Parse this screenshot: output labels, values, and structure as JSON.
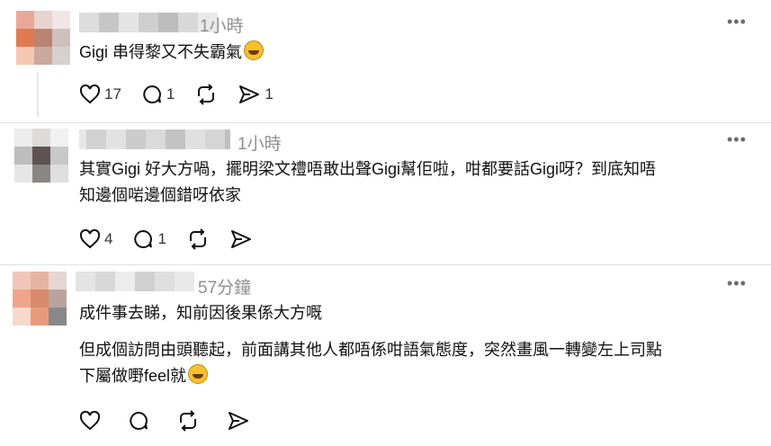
{
  "comments": [
    {
      "time": "1小時",
      "text_lines": [
        "Gigi 串得黎又不失霸氣"
      ],
      "likes": "17",
      "replies": "1",
      "shares": "1",
      "emoji": "rolling-laughing-emoji"
    },
    {
      "time": "1小時",
      "text_lines": [
        "其實Gigi 好大方喎，擺明梁文禮唔敢出聲Gigi幫佢啦，咁都要話Gigi呀？到底知唔",
        "知邊個啱邊個錯呀依家"
      ],
      "likes": "4",
      "replies": "1"
    },
    {
      "time": "57分鐘",
      "text_lines": [
        "成件事去睇，知前因後果係大方嘅",
        "但成個訪問由頭聽起，前面講其他人都唔係咁語氣態度，突然畫風一轉變左上司點",
        "下屬做嘢feel就"
      ],
      "emoji": "joy-emoji"
    }
  ],
  "icons": {
    "like": "heart-icon",
    "reply": "comment-icon",
    "repost": "repost-icon",
    "share": "send-icon",
    "more": "more-dots-icon"
  },
  "colors": {
    "text": "#111111",
    "muted": "#8f8f8f",
    "divider": "#e2e2e2"
  }
}
